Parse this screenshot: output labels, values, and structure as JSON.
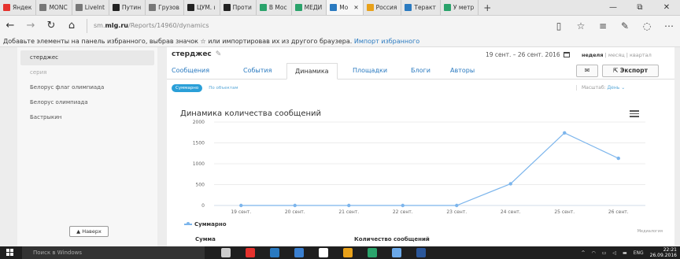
{
  "browser": {
    "tabs": [
      {
        "label": "Яндек",
        "color": "#e5322d",
        "active": false
      },
      {
        "label": "MONC",
        "color": "#777777",
        "active": false
      },
      {
        "label": "LiveInt",
        "color": "#777777",
        "active": false
      },
      {
        "label": "Путин",
        "color": "#222222",
        "active": false
      },
      {
        "label": "Грузов",
        "color": "#777777",
        "active": false
      },
      {
        "label": "ЦУМ. ı",
        "color": "#222222",
        "active": false
      },
      {
        "label": "Проти",
        "color": "#222222",
        "active": false
      },
      {
        "label": "В Мос",
        "color": "#2aa36b",
        "active": false
      },
      {
        "label": "МЕДИ",
        "color": "#2aa36b",
        "active": false
      },
      {
        "label": "Mo",
        "color": "#2a7ac0",
        "active": true
      },
      {
        "label": "Россия",
        "color": "#e8a11a",
        "active": false
      },
      {
        "label": "Теракт",
        "color": "#2a7ac0",
        "active": false
      },
      {
        "label": "У метр",
        "color": "#2aa36b",
        "active": false
      }
    ],
    "new_tab": "+",
    "window_controls": [
      "—",
      "⧉",
      "✕"
    ],
    "url_prefix": "sm.",
    "url_domain": "mlg.ru",
    "url_path": "/Reports/14960/dynamics",
    "favbar_text": "Добавьте элементы на панель избранного, выбрав значок ☆ или импортировав их из другого браузера. ",
    "favbar_link": "Импорт избранного"
  },
  "sidebar": {
    "items": [
      {
        "label": "стерджес",
        "state": "sel"
      },
      {
        "label": "серия",
        "state": "muted"
      },
      {
        "label": "Белорус флаг олимпиада",
        "state": ""
      },
      {
        "label": "Белорус олимпиада",
        "state": ""
      },
      {
        "label": "Бастрыкин",
        "state": ""
      }
    ],
    "up_button": "▲ Наверх"
  },
  "report": {
    "title": "стерджес",
    "date_range": "19 сент. – 26 сент. 2016",
    "period_week": "неделя",
    "period_month": "месяц",
    "period_quarter": "квартал",
    "sep": "|",
    "tabs": [
      "Сообщения",
      "События",
      "Динамика",
      "Площадки",
      "Блоги",
      "Авторы"
    ],
    "active_tab": "Динамика",
    "export_label": "Экспорт",
    "filter_on": "Суммарно",
    "filter_off": "По объектам",
    "scale_label": "Масштаб:",
    "scale_value": "День",
    "table_h1": "Сумма",
    "table_h2": "Количество сообщений",
    "credit": "Медиалогия"
  },
  "chart_data": {
    "type": "line",
    "title": "Динамика количества сообщений",
    "categories": [
      "19 сент.",
      "20 сент.",
      "21 сент.",
      "22 сент.",
      "23 сент.",
      "24 сент.",
      "25 сент.",
      "26 сент."
    ],
    "series": [
      {
        "name": "Суммарно",
        "values": [
          0,
          0,
          0,
          0,
          0,
          520,
          1740,
          1130
        ]
      }
    ],
    "ylim": [
      0,
      2000
    ],
    "yticks": [
      0,
      500,
      1000,
      1500,
      2000
    ],
    "grid": true,
    "legend": "bottom-left",
    "color": "#7cb5ec"
  },
  "taskbar": {
    "search": "Поиск в Windows",
    "lang": "ENG",
    "time": "22:21",
    "date": "26.09.2016",
    "apps": [
      "#cccccc",
      "#e5322d",
      "#2a7ac0",
      "#3a7fd0",
      "#ffffff",
      "#e8a11a",
      "#2aa36b",
      "#6aa8e8",
      "#2b579a"
    ]
  }
}
